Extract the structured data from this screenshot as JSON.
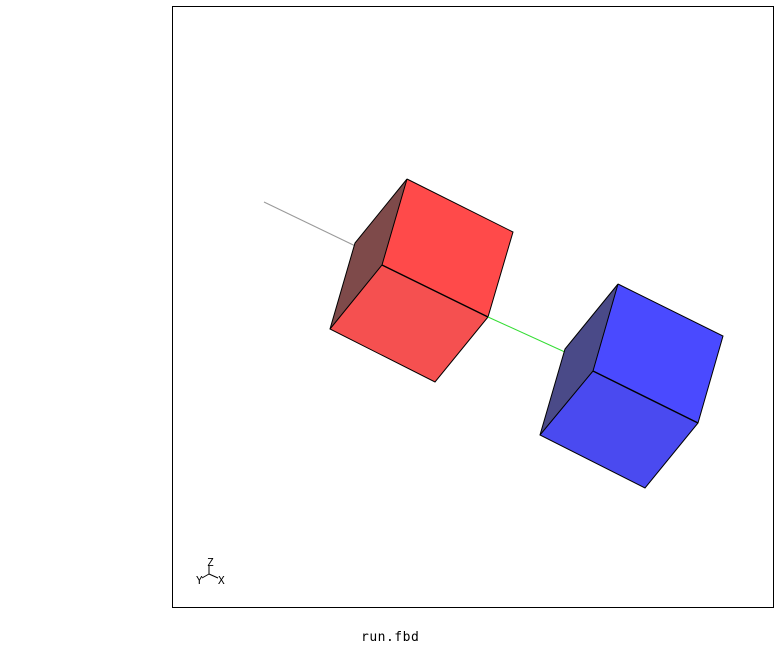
{
  "file_label": "run.fbd",
  "axes": {
    "z": "Z",
    "y": "Y",
    "x": "X"
  },
  "colors": {
    "red_top": "#ff4a4a",
    "red_front": "#f55050",
    "red_side": "#7e4a4a",
    "blue_top": "#4a4aff",
    "blue_front": "#4a4af0",
    "blue_side": "#4a4a88",
    "link_line": "#33dd33",
    "ref_line": "#999999"
  },
  "scene": {
    "objects": [
      {
        "name": "red-cube",
        "kind": "box"
      },
      {
        "name": "blue-cube",
        "kind": "box"
      }
    ]
  }
}
